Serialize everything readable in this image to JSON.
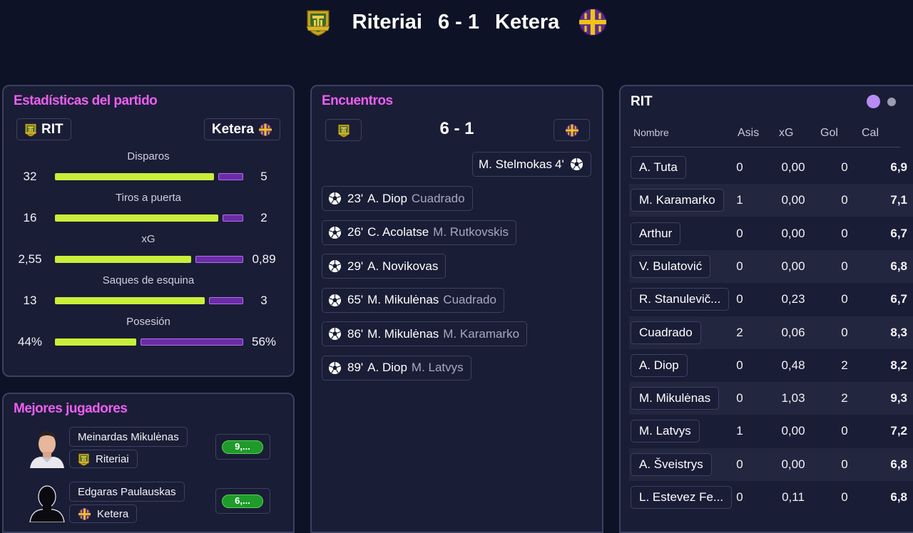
{
  "match": {
    "home_team": "Riteriai",
    "away_team": "Ketera",
    "score": "6 - 1",
    "colors": {
      "home_crest_gold": "#c9a21c",
      "home_crest_green": "#3c6b2a",
      "away_crest_purple": "#5a2d8c",
      "away_crest_yellow": "#f2c318"
    }
  },
  "stats_panel": {
    "title": "Estadísticas del partido",
    "home_label": "RIT",
    "away_label": "Ketera",
    "rows": [
      {
        "label": "Disparos",
        "home": "32",
        "away": "5",
        "home_share": 0.865
      },
      {
        "label": "Tiros a puerta",
        "home": "16",
        "away": "2",
        "home_share": 0.889
      },
      {
        "label": "xG",
        "home": "2,55",
        "away": "0,89",
        "home_share": 0.741
      },
      {
        "label": "Saques de esquina",
        "home": "13",
        "away": "3",
        "home_share": 0.8125
      },
      {
        "label": "Posesión",
        "home": "44%",
        "away": "56%",
        "home_share": 0.44
      }
    ]
  },
  "best_players": {
    "title": "Mejores jugadores",
    "players": [
      {
        "name": "Meinardas Mikulėnas",
        "club": "Riteriai",
        "rating": "9,...",
        "photo": "player-photo"
      },
      {
        "name": "Edgaras Paulauskas",
        "club": "Ketera",
        "rating": "6,...",
        "photo": "silhouette-icon"
      }
    ]
  },
  "encounters": {
    "title": "Encuentros",
    "score": "6 - 1",
    "away_events": [
      {
        "minute": "4'",
        "scorer": "M. Stelmokas",
        "assist": ""
      }
    ],
    "home_events": [
      {
        "minute": "23'",
        "scorer": "A. Diop",
        "assist": "Cuadrado"
      },
      {
        "minute": "26'",
        "scorer": "C. Acolatse",
        "assist": "M. Rutkovskis"
      },
      {
        "minute": "29'",
        "scorer": "A. Novikovas",
        "assist": ""
      },
      {
        "minute": "65'",
        "scorer": "M. Mikulėnas",
        "assist": "Cuadrado"
      },
      {
        "minute": "86'",
        "scorer": "M. Mikulėnas",
        "assist": "M. Karamarko"
      },
      {
        "minute": "89'",
        "scorer": "A. Diop",
        "assist": "M. Latvys"
      }
    ]
  },
  "team_table": {
    "title": "RIT",
    "headers": {
      "name": "Nombre",
      "assists": "Asis",
      "xg": "xG",
      "goals": "Gol",
      "rating": "Cal"
    },
    "rows": [
      {
        "name": "A. Tuta",
        "assists": "0",
        "xg": "0,00",
        "goals": "0",
        "rating": "6,9"
      },
      {
        "name": "M. Karamarko",
        "assists": "1",
        "xg": "0,00",
        "goals": "0",
        "rating": "7,1"
      },
      {
        "name": "Arthur",
        "assists": "0",
        "xg": "0,00",
        "goals": "0",
        "rating": "6,7"
      },
      {
        "name": "V. Bulatović",
        "assists": "0",
        "xg": "0,00",
        "goals": "0",
        "rating": "6,8"
      },
      {
        "name": "R. Stanulevič...",
        "assists": "0",
        "xg": "0,23",
        "goals": "0",
        "rating": "6,7"
      },
      {
        "name": "Cuadrado",
        "assists": "2",
        "xg": "0,06",
        "goals": "0",
        "rating": "8,3"
      },
      {
        "name": "A. Diop",
        "assists": "0",
        "xg": "0,48",
        "goals": "2",
        "rating": "8,2"
      },
      {
        "name": "M. Mikulėnas",
        "assists": "0",
        "xg": "1,03",
        "goals": "2",
        "rating": "9,3"
      },
      {
        "name": "M. Latvys",
        "assists": "1",
        "xg": "0,00",
        "goals": "0",
        "rating": "7,2"
      },
      {
        "name": "A. Šveistrys",
        "assists": "0",
        "xg": "0,00",
        "goals": "0",
        "rating": "6,8"
      },
      {
        "name": "L. Estevez Fe...",
        "assists": "0",
        "xg": "0,11",
        "goals": "0",
        "rating": "6,8"
      }
    ]
  }
}
